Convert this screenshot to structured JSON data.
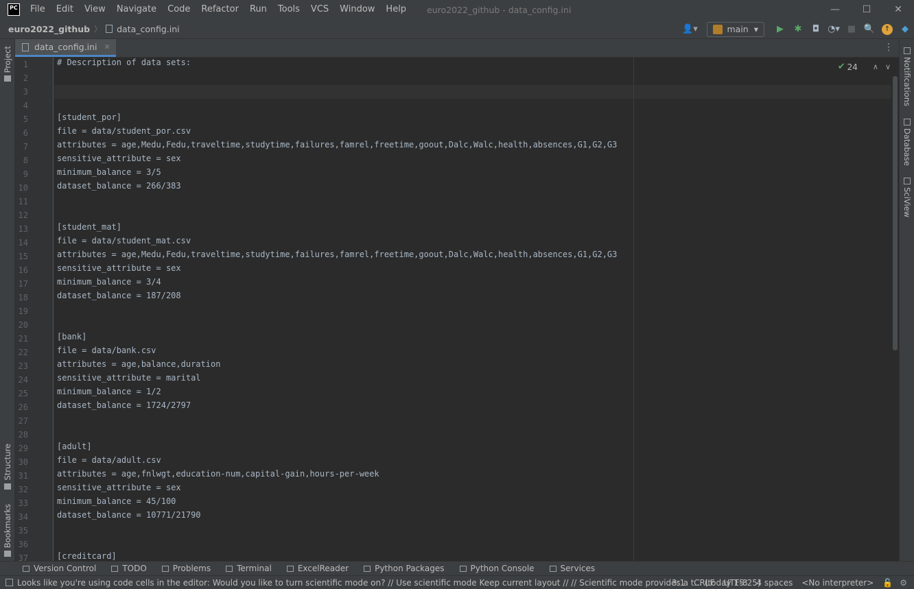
{
  "app": {
    "logo": "PC",
    "window_title": "euro2022_github - data_config.ini",
    "menu": [
      "File",
      "Edit",
      "View",
      "Navigate",
      "Code",
      "Refactor",
      "Run",
      "Tools",
      "VCS",
      "Window",
      "Help"
    ],
    "window_controls": [
      "—",
      "☐",
      "✕"
    ]
  },
  "navbar": {
    "project": "euro2022_github",
    "file": "data_config.ini",
    "run_config": "main"
  },
  "left_tools": [
    "Project",
    "Structure",
    "Bookmarks"
  ],
  "right_tools": [
    "Notifications",
    "Database",
    "SciView"
  ],
  "tab": {
    "label": "data_config.ini"
  },
  "inspection": {
    "count": "24"
  },
  "editor": {
    "lines": [
      "# Description of data sets:",
      "",
      "",
      "",
      "[student_por]",
      "file = data/student_por.csv",
      "attributes = age,Medu,Fedu,traveltime,studytime,failures,famrel,freetime,goout,Dalc,Walc,health,absences,G1,G2,G3",
      "sensitive_attribute = sex",
      "minimum_balance = 3/5",
      "dataset_balance = 266/383",
      "",
      "",
      "[student_mat]",
      "file = data/student_mat.csv",
      "attributes = age,Medu,Fedu,traveltime,studytime,failures,famrel,freetime,goout,Dalc,Walc,health,absences,G1,G2,G3",
      "sensitive_attribute = sex",
      "minimum_balance = 3/4",
      "dataset_balance = 187/208",
      "",
      "",
      "[bank]",
      "file = data/bank.csv",
      "attributes = age,balance,duration",
      "sensitive_attribute = marital",
      "minimum_balance = 1/2",
      "dataset_balance = 1724/2797",
      "",
      "",
      "[adult]",
      "file = data/adult.csv",
      "attributes = age,fnlwgt,education-num,capital-gain,hours-per-week",
      "sensitive_attribute = sex",
      "minimum_balance = 45/100",
      "dataset_balance = 10771/21790",
      "",
      "",
      "[creditcard]"
    ]
  },
  "tool_windows": [
    "Version Control",
    "TODO",
    "Problems",
    "Terminal",
    "ExcelReader",
    "Python Packages",
    "Python Console",
    "Services"
  ],
  "status": {
    "message": "Looks like you're using code cells in the editor: Would you like to turn scientific mode on? // Use scientific mode  Keep current layout // // Scientific mode provides a t... (today 15:25)",
    "position": "3:1",
    "line_sep": "CRLF",
    "encoding": "UTF-8",
    "indent": "4 spaces",
    "interpreter": "<No interpreter>"
  },
  "colors": {
    "accent": "#4a88c7",
    "run_green": "#59a869",
    "editor_bg": "#2b2b2b",
    "chrome_bg": "#3c3f41"
  }
}
